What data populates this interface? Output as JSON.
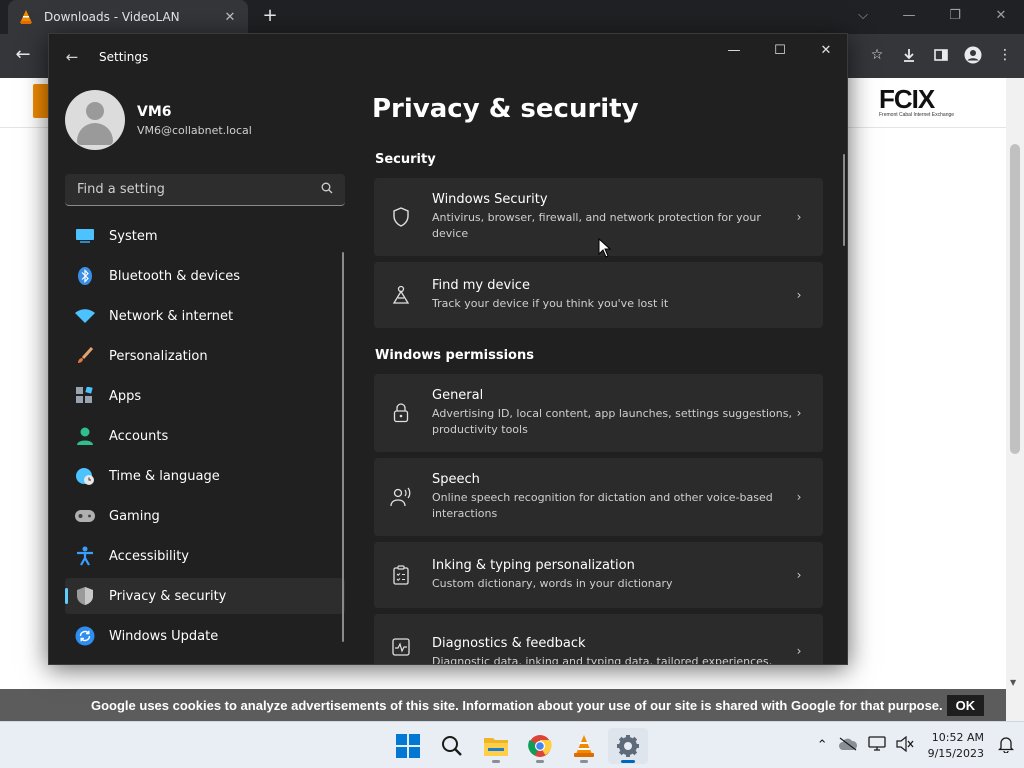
{
  "browser": {
    "tab_title": "Downloads - VideoLAN",
    "tab_close": "✕",
    "new_tab": "+",
    "window_controls": {
      "chevron": "⌵",
      "minimize": "—",
      "restore": "❐",
      "close": "✕"
    },
    "toolbar_icons": [
      "bookmark-star-icon",
      "download-icon",
      "side-panel-icon",
      "profile-icon",
      "more-menu-icon"
    ]
  },
  "webpage": {
    "logo": "FCIX",
    "logo_sub": "Fremont Cabal Internet Exchange",
    "cookie_message": "Google uses cookies to analyze advertisements of this site. Information about your use of our site is shared with Google for that purpose.",
    "cookie_ok": "OK"
  },
  "settings": {
    "window_title": "Settings",
    "profile": {
      "name": "VM6",
      "email": "VM6@collabnet.local"
    },
    "search": {
      "placeholder": "Find a setting"
    },
    "nav": [
      {
        "label": "System",
        "icon": "system-icon",
        "color": "#4cc2ff"
      },
      {
        "label": "Bluetooth & devices",
        "icon": "bluetooth-icon",
        "color": "#3a8ee6"
      },
      {
        "label": "Network & internet",
        "icon": "wifi-icon",
        "color": "#4cc2ff"
      },
      {
        "label": "Personalization",
        "icon": "paintbrush-icon",
        "color": "#e3a46c"
      },
      {
        "label": "Apps",
        "icon": "apps-icon",
        "color": "#9aa4b0"
      },
      {
        "label": "Accounts",
        "icon": "accounts-icon",
        "color": "#2fbf8f"
      },
      {
        "label": "Time & language",
        "icon": "globe-clock-icon",
        "color": "#4cc2ff"
      },
      {
        "label": "Gaming",
        "icon": "gamepad-icon",
        "color": "#b0b0b0"
      },
      {
        "label": "Accessibility",
        "icon": "accessibility-icon",
        "color": "#3aa0ff"
      },
      {
        "label": "Privacy & security",
        "icon": "shield-icon",
        "color": "#9a9a9a",
        "active": true
      },
      {
        "label": "Windows Update",
        "icon": "update-icon",
        "color": "#2e8ef0"
      }
    ],
    "page_title": "Privacy & security",
    "sections": {
      "security": "Security",
      "windows_permissions": "Windows permissions"
    },
    "cards": [
      {
        "title": "Windows Security",
        "desc": "Antivirus, browser, firewall, and network protection for your device",
        "icon": "shield-icon"
      },
      {
        "title": "Find my device",
        "desc": "Track your device if you think you've lost it",
        "icon": "find-device-icon"
      },
      {
        "title": "General",
        "desc": "Advertising ID, local content, app launches, settings suggestions, productivity tools",
        "icon": "lock-icon"
      },
      {
        "title": "Speech",
        "desc": "Online speech recognition for dictation and other voice-based interactions",
        "icon": "speech-icon"
      },
      {
        "title": "Inking & typing personalization",
        "desc": "Custom dictionary, words in your dictionary",
        "icon": "clipboard-list-icon"
      },
      {
        "title": "Diagnostics & feedback",
        "desc": "Diagnostic data, inking and typing data, tailored experiences,",
        "icon": "diagnostics-icon"
      }
    ]
  },
  "taskbar": {
    "apps": [
      "start-icon",
      "search-icon",
      "file-explorer-icon",
      "chrome-icon",
      "vlc-icon",
      "settings-icon"
    ],
    "clock_time": "10:52 AM",
    "clock_date": "9/15/2023"
  }
}
